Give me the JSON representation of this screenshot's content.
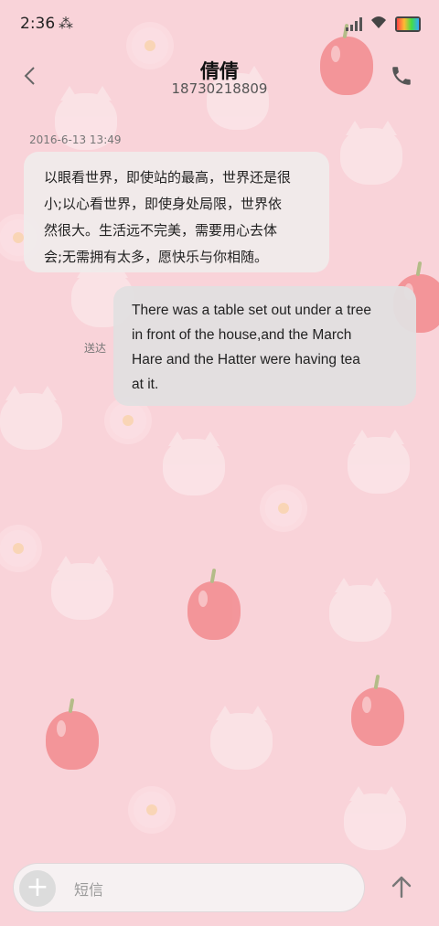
{
  "status_bar": {
    "time": "2:36",
    "bluetooth_icon": "bluetooth-icon",
    "signal_icon": "signal-icon",
    "wifi_icon": "wifi-icon",
    "battery_icon": "battery-icon"
  },
  "header": {
    "contact_name": "倩倩",
    "contact_number": "18730218809",
    "back_icon": "chevron-left-icon",
    "call_icon": "phone-icon"
  },
  "conversation": {
    "timestamp": "2016-6-13 13:49",
    "messages": [
      {
        "direction": "incoming",
        "lines": [
          "以眼看世界，即使站的最高，世界还是很",
          "小;以心看世界，即使身处局限，世界依",
          "然很大。生活远不完美，需要用心去体",
          "会;无需拥有太多，愿快乐与你相随。"
        ]
      },
      {
        "direction": "outgoing",
        "lines": [
          "There was a table set out under a tree",
          "in front of the house,and the March",
          "Hare and the Hatter were having tea",
          "at it."
        ],
        "status": "送达"
      }
    ]
  },
  "composer": {
    "placeholder": "短信",
    "add_icon": "plus-icon",
    "send_icon": "arrow-up-icon"
  },
  "colors": {
    "background": "#f9d3d9",
    "bubble_incoming": "#f0ebec",
    "bubble_outgoing": "#e1dfe0"
  }
}
